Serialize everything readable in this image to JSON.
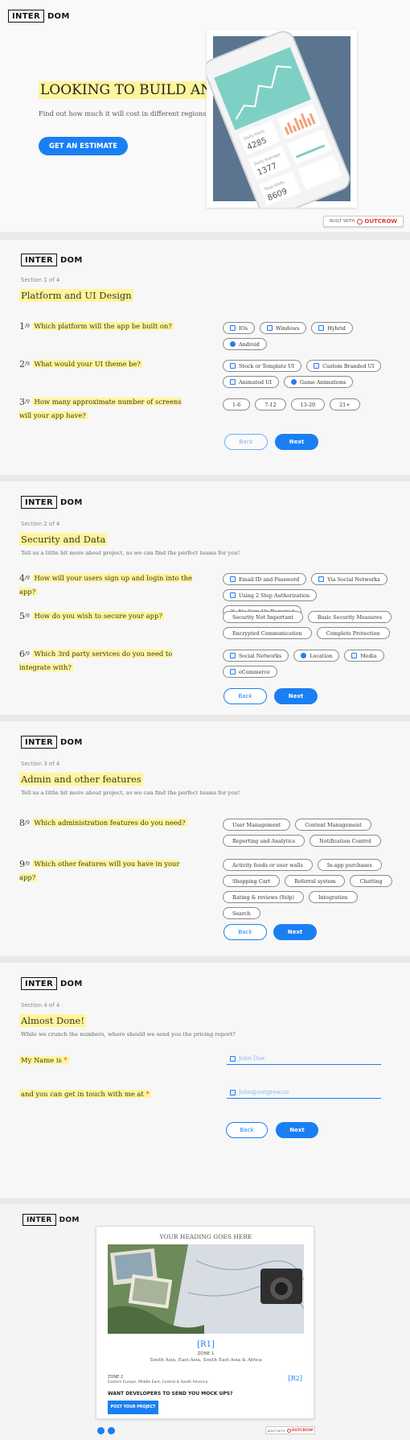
{
  "brand": {
    "box": "INTER",
    "rest": "DOM"
  },
  "hero": {
    "title": "LOOKING TO BUILD AN APP?",
    "subtitle": "Find out how much it will cost in different regions!",
    "cta": "GET AN ESTIMATE",
    "badge_prefix": "BUILT WITH",
    "badge_brand": "OUTCROW",
    "phone": {
      "stat1_label": "Daily Visits",
      "stat1_value": "4285",
      "stat2_label": "Daily Average",
      "stat2_value": "1377",
      "stat3_label": "Total Visits",
      "stat3_value": "8609"
    }
  },
  "s1": {
    "section": "Section 1 of 4",
    "title": "Platform and UI Design",
    "q1": {
      "num": "1",
      "den": "9",
      "text": "Which platform will the app be built on?",
      "options": [
        "IOs",
        "Windows",
        "Hybrid",
        "Android"
      ]
    },
    "q2": {
      "num": "2",
      "den": "9",
      "text": "What would your UI theme be?",
      "options": [
        "Stock or Template UI",
        "Custom Branded UI",
        "Animated UI",
        "Game Animations"
      ]
    },
    "q3": {
      "num": "3",
      "den": "9",
      "text": "How many approximate number of screens will your app have?",
      "options": [
        "1-6",
        "7-12",
        "13-20",
        "21+"
      ]
    },
    "back": "Back",
    "next": "Next"
  },
  "s2": {
    "section": "Section 2 of 4",
    "title": "Security and Data",
    "subtitle": "Tell us a little bit more about project, so we can find the perfect teams for you!",
    "q4": {
      "num": "4",
      "den": "9",
      "text": "How will your users sign up and login into the app?",
      "options": [
        "Email ID and Password",
        "Via Social Networks",
        "Using 2 Step Authorization",
        "No Sign Up Required"
      ]
    },
    "q5": {
      "num": "5",
      "den": "9",
      "text": "How do you wish to secure your app?",
      "options": [
        "Security Not Important",
        "Basic Security Measures",
        "Encrypted Communication",
        "Complete Protection"
      ]
    },
    "q6": {
      "num": "6",
      "den": "9",
      "text": "Which 3rd party services do you need to integrate with?",
      "options": [
        "Social Networks",
        "Location",
        "Media",
        "eCommerce"
      ]
    },
    "back": "Back",
    "next": "Next"
  },
  "s3": {
    "section": "Section 3 of 4",
    "title": "Admin and other features",
    "subtitle": "Tell us a little bit more about project, so we can find the perfect teams for you!",
    "q8": {
      "num": "8",
      "den": "9",
      "text": "Which administration features do you need?",
      "options": [
        "User Management",
        "Content Management",
        "Reporting and Analytics",
        "Notification Control"
      ]
    },
    "q9": {
      "num": "9",
      "den": "9",
      "text": "Which other features will you have in your app?",
      "options": [
        "Activity feeds or user walls",
        "In-app purchases",
        "Shopping Cart",
        "Referral system",
        "Chatting",
        "Rating & reviews (Yelp)",
        "Integration",
        "Search"
      ]
    },
    "back": "Back",
    "next": "Next"
  },
  "s4": {
    "section": "Section 4 of 4",
    "title": "Almost Done!",
    "subtitle": "While we crunch the numbers, where should we send you the pricing report?",
    "name_label": "My Name is",
    "name_placeholder": "John Doe",
    "email_label": "and you can get in touch with me at",
    "email_placeholder": "John@outgrow.co",
    "required": "*",
    "back": "Back",
    "next": "Next"
  },
  "result": {
    "heading": "YOUR HEADING GOES HERE",
    "r1": "[R1]",
    "zone1": "ZONE 1",
    "zone1_regions": "South Asia, East Asia, South East Asia & Africa",
    "zone2": "ZONE 2",
    "zone2_regions": "Eastern Europe, Middle East, Central & South America",
    "r2": "[R2]",
    "cta_text": "WANT DEVELOPERS TO SEND YOU MOCK UPS?",
    "cta_button": "POST YOUR PROJECT",
    "badge_prefix": "BUILT WITH",
    "badge_brand": "OUTCROW"
  },
  "colors": {
    "accent": "#1a7ff2",
    "highlight": "#fff59d",
    "badge_red": "#e53935"
  }
}
